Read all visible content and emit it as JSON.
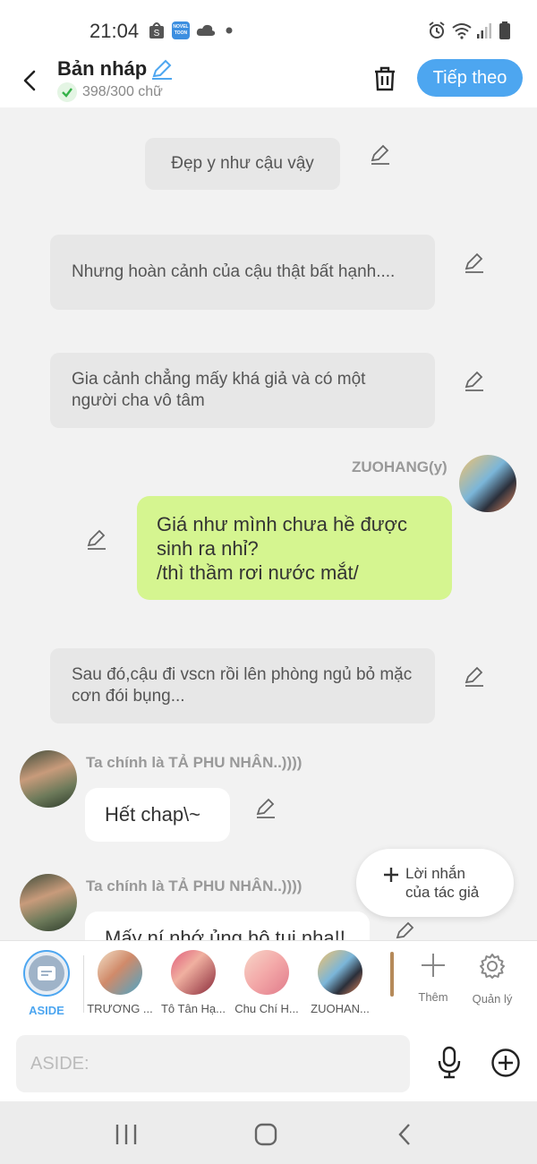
{
  "status_bar": {
    "time": "21:04",
    "icons": [
      "shopee-icon",
      "novel-toon-icon",
      "cloud-icon",
      "dot-icon",
      "alarm-icon",
      "wifi-icon",
      "signal-icon",
      "battery-icon"
    ],
    "novel_toon_label": "NOVEL TOON"
  },
  "header": {
    "title": "Bản nháp",
    "word_count": "398/300 chữ",
    "next_label": "Tiếp theo"
  },
  "chat": {
    "messages": [
      {
        "type": "narration",
        "text": "Đẹp y như cậu vậy"
      },
      {
        "type": "narration",
        "text": "Nhưng hoàn cảnh của cậu thật bất hạnh...."
      },
      {
        "type": "narration",
        "text": "Gia cảnh chẳng mấy khá giả và có một người cha vô tâm"
      },
      {
        "type": "character",
        "sender": "ZUOHANG(y)",
        "side": "right",
        "text": "Giá như mình chưa hề được sinh ra nhỉ?\n/thì thầm rơi nước mắt/"
      },
      {
        "type": "narration",
        "text": "Sau đó,cậu đi vscn rồi lên phòng ngủ bỏ mặc cơn đói bụng..."
      },
      {
        "type": "character",
        "sender": "Ta chính là TẢ PHU NHÂN..))))",
        "side": "left",
        "text": "Hết chap\\~"
      },
      {
        "type": "character",
        "sender": "Ta chính là TẢ PHU NHÂN..))))",
        "side": "left",
        "text": "Mấy ní nhớ ủng hộ tui nha!!"
      }
    ],
    "author_note_label": "Lời nhắn của tác giả"
  },
  "character_bar": {
    "items": [
      {
        "label": "ASIDE"
      },
      {
        "label": "TRƯƠNG ..."
      },
      {
        "label": "Tô Tân Hạ..."
      },
      {
        "label": "Chu Chí H..."
      },
      {
        "label": "ZUOHAN..."
      }
    ],
    "add_label": "Thêm",
    "manage_label": "Quản lý"
  },
  "input": {
    "placeholder": "ASIDE:"
  },
  "colors": {
    "accent": "#4da6f0",
    "green_bubble": "#d5f590",
    "narration_bg": "#e7e7e7"
  }
}
